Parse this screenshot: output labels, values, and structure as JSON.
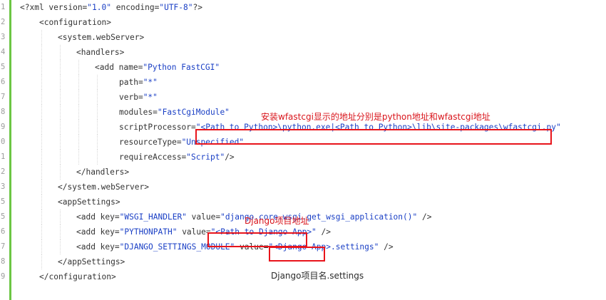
{
  "lines": [
    {
      "num": "1",
      "segs": [
        {
          "t": "<?xml version="
        },
        {
          "t": "\"1.0\"",
          "s": 1
        },
        {
          "t": " encoding="
        },
        {
          "t": "\"UTF-8\"",
          "s": 1
        },
        {
          "t": "?>"
        }
      ]
    },
    {
      "num": "2",
      "segs": [
        {
          "t": "<configuration>"
        }
      ]
    },
    {
      "num": "3",
      "segs": [
        {
          "t": "<system.webServer>"
        }
      ]
    },
    {
      "num": "4",
      "segs": [
        {
          "t": "<handlers>"
        }
      ]
    },
    {
      "num": "5",
      "segs": [
        {
          "t": "<add name="
        },
        {
          "t": "\"Python FastCGI\"",
          "s": 1
        }
      ]
    },
    {
      "num": "6",
      "segs": [
        {
          "t": "path="
        },
        {
          "t": "\"*\"",
          "s": 1
        }
      ]
    },
    {
      "num": "7",
      "segs": [
        {
          "t": "verb="
        },
        {
          "t": "\"*\"",
          "s": 1
        }
      ]
    },
    {
      "num": "8",
      "segs": [
        {
          "t": "modules="
        },
        {
          "t": "\"FastCgiModule\"",
          "s": 1
        }
      ]
    },
    {
      "num": "9",
      "segs": [
        {
          "t": "scriptProcessor="
        },
        {
          "t": "\"<Path to Python>\\python.exe|<Path to Python>\\lib\\site-packages\\wfastcgi.py\"",
          "s": 1
        }
      ]
    },
    {
      "num": "0",
      "segs": [
        {
          "t": "resourceType="
        },
        {
          "t": "\"Unspecified\"",
          "s": 1
        }
      ]
    },
    {
      "num": "1",
      "segs": [
        {
          "t": "requireAccess="
        },
        {
          "t": "\"Script\"",
          "s": 1
        },
        {
          "t": "/>"
        }
      ]
    },
    {
      "num": "2",
      "segs": [
        {
          "t": "</handlers>"
        }
      ]
    },
    {
      "num": "3",
      "segs": [
        {
          "t": "</system.webServer>"
        }
      ]
    },
    {
      "num": "5",
      "segs": [
        {
          "t": "<appSettings>"
        }
      ]
    },
    {
      "num": "5",
      "segs": [
        {
          "t": "<add key="
        },
        {
          "t": "\"WSGI_HANDLER\"",
          "s": 1
        },
        {
          "t": " value="
        },
        {
          "t": "\"django.core.wsgi.get_wsgi_application()\"",
          "s": 1
        },
        {
          "t": " />"
        }
      ]
    },
    {
      "num": "6",
      "segs": [
        {
          "t": "<add key="
        },
        {
          "t": "\"PYTHONPATH\"",
          "s": 1
        },
        {
          "t": " value="
        },
        {
          "t": "\"<Path to Django App>\"",
          "s": 1
        },
        {
          "t": " />"
        }
      ]
    },
    {
      "num": "7",
      "segs": [
        {
          "t": "<add key="
        },
        {
          "t": "\"DJANGO_SETTINGS_MODULE\"",
          "s": 1
        },
        {
          "t": " value="
        },
        {
          "t": "\"<Django App>.settings\"",
          "s": 1
        },
        {
          "t": " />"
        }
      ]
    },
    {
      "num": "8",
      "segs": [
        {
          "t": "</appSettings>"
        }
      ]
    },
    {
      "num": "9",
      "segs": [
        {
          "t": "</configuration>"
        }
      ]
    }
  ],
  "annotations": {
    "wfastcgi_note": "安装wfastcgi显示的地址分别是python地址和wfastcgi地址",
    "django_path_note": "Django项目地址",
    "django_settings_note": "Django项目名.settings"
  },
  "colors": {
    "string": "#1a3fc5",
    "text": "#333333",
    "gutter_bar": "#6cc644",
    "highlight": "#e8141b"
  }
}
